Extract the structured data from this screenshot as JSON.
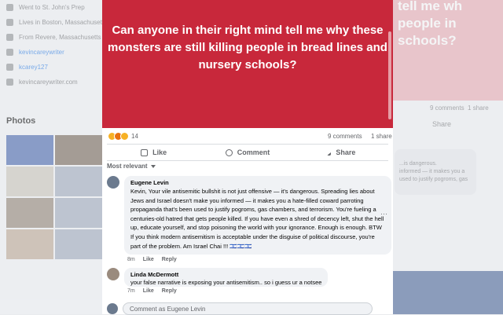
{
  "background_left": {
    "intro": [
      {
        "icon": "school-icon",
        "text": "Went to St. John's Prep"
      },
      {
        "icon": "home-icon",
        "text": "Lives in Boston, Massachusetts"
      },
      {
        "icon": "location-pin-icon",
        "text": "From Revere, Massachusetts"
      },
      {
        "icon": "instagram-icon",
        "text": "kevincareywriter"
      },
      {
        "icon": "twitter-icon",
        "text": "kcarey127"
      },
      {
        "icon": "globe-icon",
        "text": "kevincareywriter.com"
      }
    ],
    "photos_title": "Photos"
  },
  "background_right": {
    "quote_fragment": "tell me wh\npeople in\nschools?",
    "comments": "9 comments",
    "shares": "1 share",
    "share_label": "Share",
    "comment_fragment": "...is dangerous.\ninformed — it makes you a\nused to justify pogroms, gas"
  },
  "post": {
    "image_text": "Can anyone in their right mind tell me why these monsters are still killing people in bread lines and nursery schools?",
    "image_color": "#c8283b",
    "reaction_count": "14",
    "comments_count": "9 comments",
    "shares_count": "1 share",
    "actions": {
      "like": "Like",
      "comment": "Comment",
      "share": "Share"
    },
    "sort_label": "Most relevant",
    "comments": [
      {
        "author": "Eugene Levin",
        "text": "Kevin, Your vile antisemitic bullshit is not just offensive — it's dangerous. Spreading lies about Jews and Israel doesn't make you informed — it makes you a hate-filled coward parroting propaganda that's been used to justify pogroms, gas chambers, and terrorism. You're fueling a centuries-old hatred that gets people killed. If you have even a shred of decency left, shut the hell up, educate yourself, and stop poisoning the world with your ignorance. Enough is enough. BTW If you think modern antisemitism is acceptable under the disguise of political discourse, you're part of the problem. Am Israel Chai !!! 🇮🇱🇮🇱🇮🇱",
        "time": "8m",
        "like": "Like",
        "reply": "Reply"
      },
      {
        "author": "Linda McDermott",
        "text": "your false narrative is exposing your antisemitism.. so i guess ur a notsee",
        "time": "7m",
        "like": "Like",
        "reply": "Reply"
      }
    ],
    "input_placeholder": "Comment as Eugene Levin",
    "more_label": "···"
  }
}
